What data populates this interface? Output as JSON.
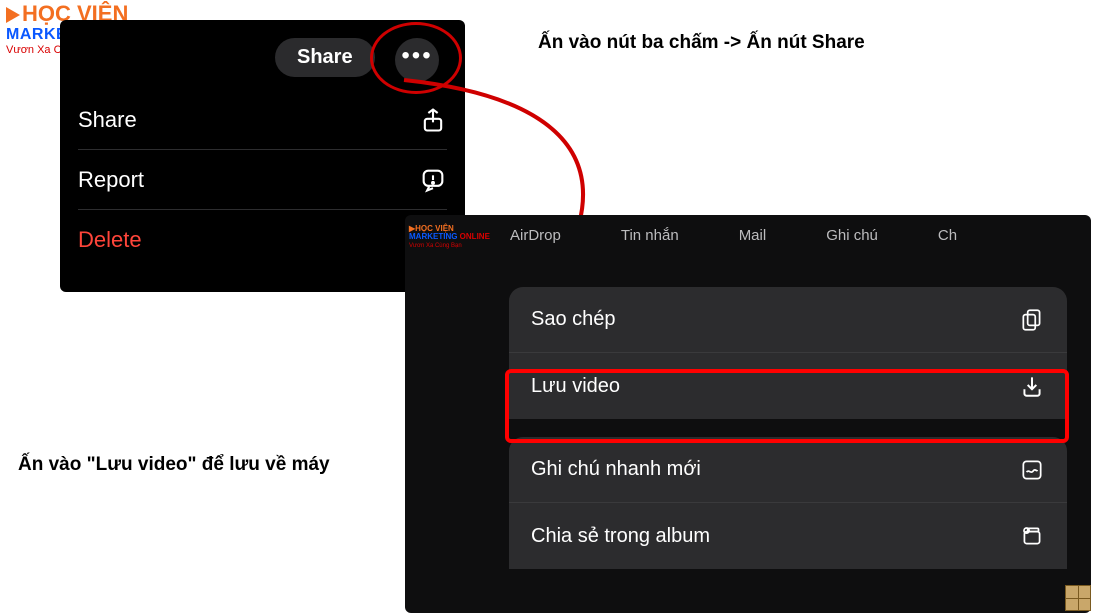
{
  "logo": {
    "line1": "HỌC VIỆN",
    "line2_a": "MARKETING",
    "line2_b": " ONLINE",
    "tagline": "Vươn Xa Cùng Bạn"
  },
  "annotations": {
    "top": "Ấn vào nút ba chấm -> Ấn nút Share",
    "left": "Ấn vào \"Lưu video\" để lưu về máy"
  },
  "panel1": {
    "share_btn": "Share",
    "items": [
      {
        "label": "Share"
      },
      {
        "label": "Report"
      },
      {
        "label": "Delete"
      }
    ]
  },
  "panel2": {
    "apps": [
      "AirDrop",
      "Tin nhắn",
      "Mail",
      "Ghi chú",
      "Ch"
    ],
    "group1": [
      {
        "label": "Sao chép"
      },
      {
        "label": "Lưu video"
      }
    ],
    "group2": [
      {
        "label": "Ghi chú nhanh mới"
      },
      {
        "label": "Chia sẻ trong album"
      }
    ]
  }
}
